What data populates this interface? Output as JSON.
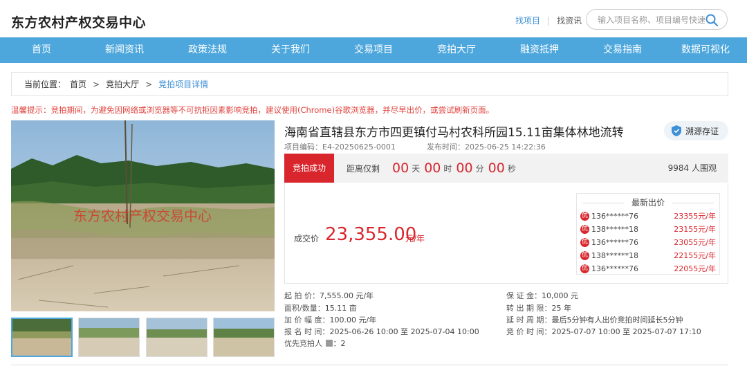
{
  "header": {
    "logo": "东方农村产权交易中心",
    "links": [
      "找项目",
      "找资讯"
    ],
    "search_placeholder": "输入项目名称、项目编号快速"
  },
  "nav": [
    "首页",
    "新闻资讯",
    "政策法规",
    "关于我们",
    "交易项目",
    "竞拍大厅",
    "融资抵押",
    "交易指南",
    "数据可视化"
  ],
  "breadcrumb": {
    "prefix": "当前位置：",
    "items": [
      "首页",
      "竞拍大厅",
      "竞拍项目详情"
    ]
  },
  "tip": "温馨提示：竞拍期间，为避免因网络或浏览器等不可抗拒因素影响竞拍，建议使用(Chrome)谷歌浏览器，并尽早出价，或尝试刷新页面。",
  "gallery": {
    "watermark": "东方农村产权交易中心",
    "thumb_count": 4
  },
  "project": {
    "title": "海南省直辖县东方市四更镇付马村农科所园15.11亩集体林地流转",
    "trace_label": "溯源存证",
    "code": "项目编码：E4-20250625-0001",
    "published": "发布时间：2025-06-25 14:22:36"
  },
  "status": {
    "badge": "竞拍成功",
    "countdown_label": "距离仅剩",
    "days": "00",
    "days_unit": "天",
    "hours": "00",
    "hours_unit": "时",
    "minutes": "00",
    "minutes_unit": "分",
    "seconds": "00",
    "seconds_unit": "秒",
    "viewers": "9984 人围观"
  },
  "deal": {
    "label": "成交价",
    "price": "23,355.00",
    "unit": "元/年"
  },
  "bids": {
    "title": "最新出价",
    "badge": "优",
    "rows": [
      {
        "user": "136******76",
        "amount": "23355元/年"
      },
      {
        "user": "138******18",
        "amount": "23155元/年"
      },
      {
        "user": "136******76",
        "amount": "23055元/年"
      },
      {
        "user": "138******18",
        "amount": "22155元/年"
      },
      {
        "user": "136******76",
        "amount": "22055元/年"
      }
    ]
  },
  "details": {
    "start_price": {
      "k": "起 拍 价：",
      "v": "7,555.00 元/年"
    },
    "deposit": {
      "k": "保 证 金：",
      "v": "10,000 元"
    },
    "area": {
      "k": "面积/数量：",
      "v": "15.11 亩"
    },
    "term": {
      "k": "转 出 期 限：",
      "v": "25 年"
    },
    "increment": {
      "k": "加 价 幅 度：",
      "v": "100.00 元/年"
    },
    "delay": {
      "k": "延 时 周 期：",
      "v": "最后5分钟有人出价竞拍时间延长5分钟"
    },
    "signup": {
      "k": "报 名 时 间：",
      "v": "2025-06-26 10:00 至 2025-07-04 10:00"
    },
    "auction_time": {
      "k": "竞 价 时 间：",
      "v": "2025-07-07 10:00 至 2025-07-07 17:10"
    },
    "priority": {
      "k": "优先竞拍人",
      "v": "：2"
    }
  }
}
